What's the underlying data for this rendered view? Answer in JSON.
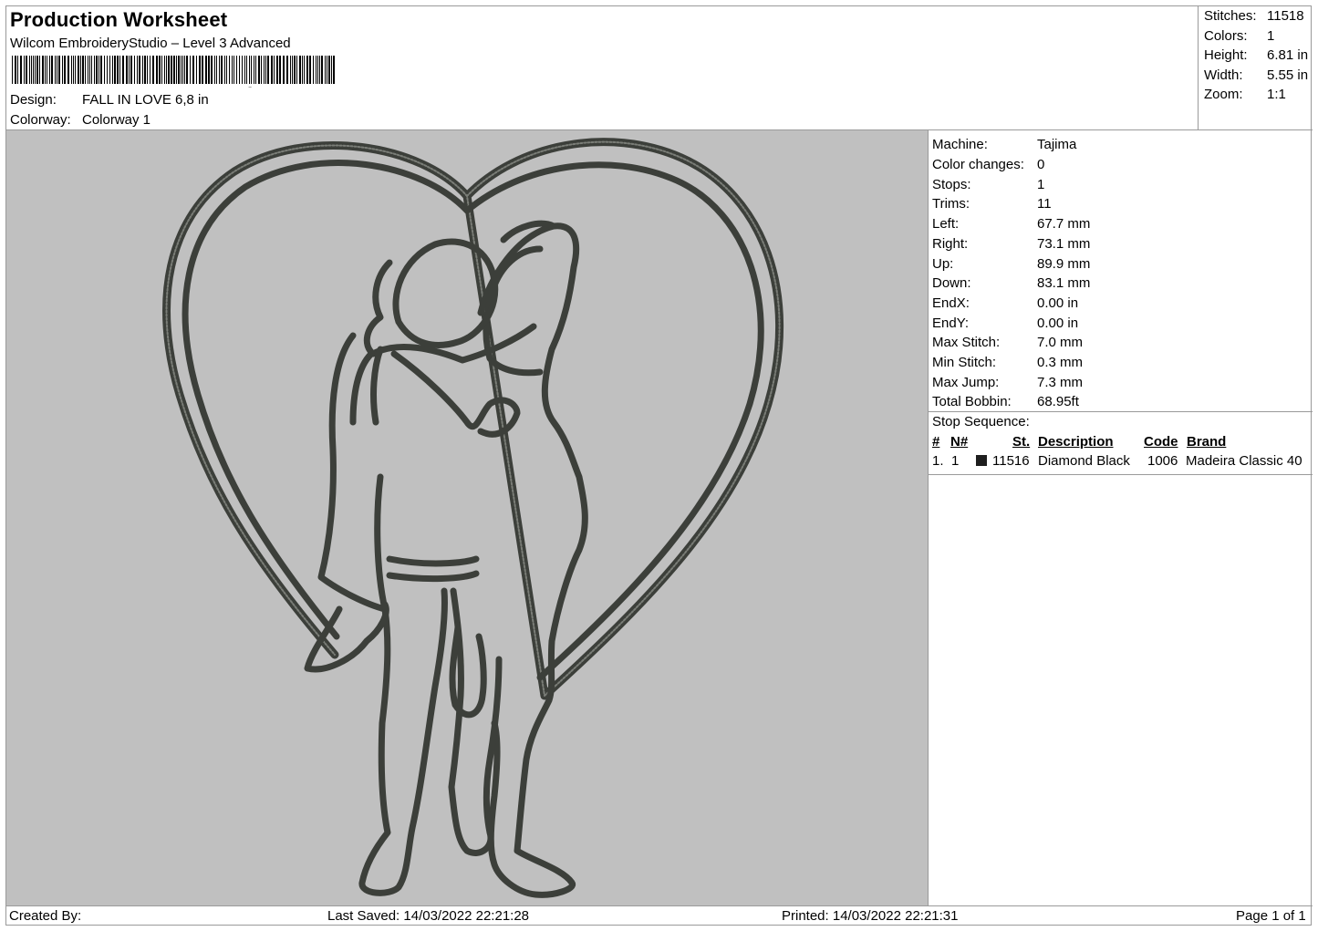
{
  "header": {
    "title": "Production Worksheet",
    "subtitle": "Wilcom EmbroideryStudio – Level 3 Advanced",
    "design_label": "Design:",
    "design_value": "FALL IN LOVE 6,8 in",
    "colorway_label": "Colorway:",
    "colorway_value": "Colorway 1"
  },
  "summary": {
    "stitches_label": "Stitches:",
    "stitches_value": "11518",
    "colors_label": "Colors:",
    "colors_value": "1",
    "height_label": "Height:",
    "height_value": "6.81 in",
    "width_label": "Width:",
    "width_value": "5.55 in",
    "zoom_label": "Zoom:",
    "zoom_value": "1:1"
  },
  "info": {
    "machine_label": "Machine:",
    "machine_value": "Tajima",
    "color_changes_label": "Color changes:",
    "color_changes_value": "0",
    "stops_label": "Stops:",
    "stops_value": "1",
    "trims_label": "Trims:",
    "trims_value": "11",
    "left_label": "Left:",
    "left_value": "67.7 mm",
    "right_label": "Right:",
    "right_value": "73.1 mm",
    "up_label": "Up:",
    "up_value": "89.9 mm",
    "down_label": "Down:",
    "down_value": "83.1 mm",
    "endx_label": "EndX:",
    "endx_value": "0.00 in",
    "endy_label": "EndY:",
    "endy_value": "0.00 in",
    "max_stitch_label": "Max Stitch:",
    "max_stitch_value": "7.0 mm",
    "min_stitch_label": "Min Stitch:",
    "min_stitch_value": "0.3 mm",
    "max_jump_label": "Max Jump:",
    "max_jump_value": "7.3 mm",
    "total_bobbin_label": "Total Bobbin:",
    "total_bobbin_value": "68.95ft"
  },
  "stop_sequence": {
    "title": "Stop Sequence:",
    "headers": {
      "idx": "#",
      "needle": "N#",
      "stitches": "St.",
      "description": "Description",
      "code": "Code",
      "brand": "Brand"
    },
    "rows": [
      {
        "idx": "1.",
        "needle": "1",
        "swatch": "#1e1e1e",
        "stitches": "11516",
        "description": "Diamond Black",
        "code": "1006",
        "brand": "Madeira Classic 40"
      }
    ]
  },
  "preview": {
    "background": "#c0c0c0",
    "thread_color": "#3c3f3a"
  },
  "footer": {
    "created_by": "Created By:",
    "last_saved": "Last Saved: 14/03/2022 22:21:28",
    "printed": "Printed: 14/03/2022 22:21:31",
    "page": "Page 1 of 1"
  }
}
